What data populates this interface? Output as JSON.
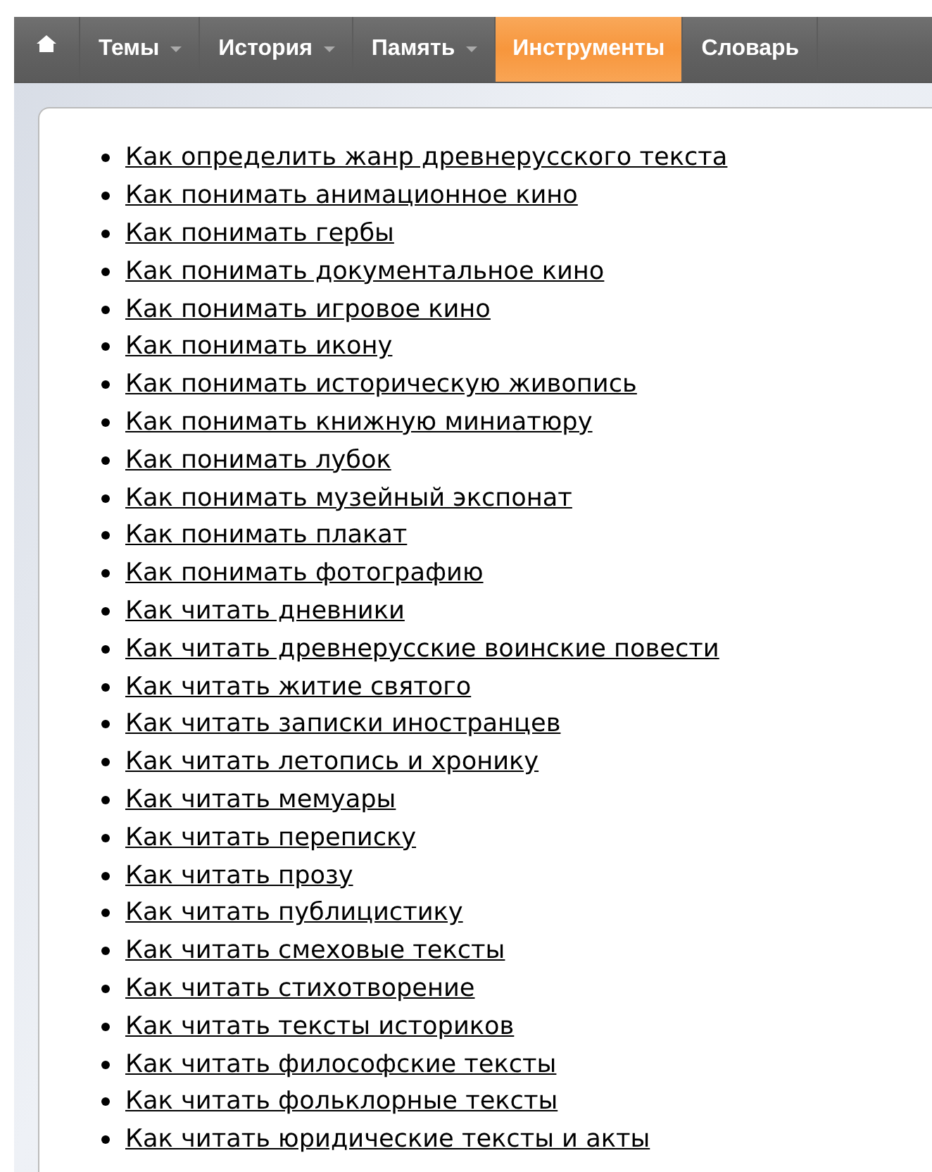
{
  "nav": [
    {
      "label": "Темы",
      "dropdown": true,
      "selected": false
    },
    {
      "label": "История",
      "dropdown": true,
      "selected": false
    },
    {
      "label": "Память",
      "dropdown": true,
      "selected": false
    },
    {
      "label": "Инструменты",
      "dropdown": false,
      "selected": true
    },
    {
      "label": "Словарь",
      "dropdown": false,
      "selected": false
    }
  ],
  "links": [
    "Как определить жанр древнерусского текста",
    "Как понимать анимационное кино",
    "Как понимать гербы",
    "Как понимать документальное кино",
    "Как понимать игровое кино",
    "Как понимать икону",
    "Как понимать историческую живопись",
    "Как понимать книжную миниатюру",
    "Как понимать лубок",
    "Как понимать музейный экспонат",
    "Как понимать плакат",
    "Как понимать фотографию",
    "Как читать дневники",
    "Как читать древнерусские воинские повести",
    "Как читать житие святого",
    "Как читать записки иностранцев",
    "Как читать летопись и хронику",
    "Как читать мемуары",
    "Как читать переписку",
    "Как читать прозу",
    "Как читать публицистику",
    "Как читать смеховые тексты",
    "Как читать стихотворение",
    "Как читать тексты историков",
    "Как читать философские тексты",
    "Как читать фольклорные тексты",
    "Как читать юридические тексты и акты"
  ]
}
